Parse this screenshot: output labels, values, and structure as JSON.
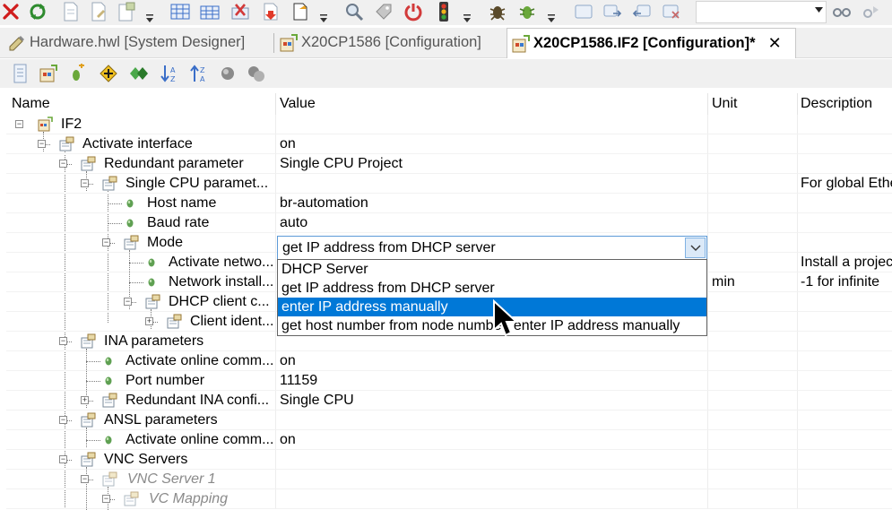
{
  "toolbar": {
    "icons": [
      "close-icon",
      "refresh-icon",
      "page-icon",
      "page-edit-icon",
      "page-settings-icon",
      "dropdown-arrow",
      "grid-icon",
      "grid-add-icon",
      "delete-icon",
      "download-icon",
      "page-open-icon",
      "dropdown-arrow",
      "search-icon",
      "tag-icon",
      "power-icon",
      "traffic-light-icon",
      "dropdown-arrow",
      "bug-icon",
      "bug-run-icon",
      "dropdown-arrow",
      "window-icon",
      "forward-icon",
      "back-icon",
      "window-close-icon"
    ],
    "combo_value": ""
  },
  "tabs": [
    {
      "label": "Hardware.hwl [System Designer]",
      "active": false
    },
    {
      "label": "X20CP1586 [Configuration]",
      "active": false
    },
    {
      "label": "X20CP1586.IF2 [Configuration]*",
      "active": true,
      "close": "✕"
    }
  ],
  "subtoolbar": {
    "icons": [
      "properties-icon",
      "module-icon",
      "leaf-add-icon",
      "diamond-icon",
      "diamonds-icon",
      "sort-desc-icon",
      "sort-asc-icon",
      "circle-icon",
      "circles-icon"
    ]
  },
  "grid": {
    "columns": [
      "Name",
      "Value",
      "Unit",
      "Description"
    ],
    "rows": [
      {
        "name": "IF2",
        "value": "",
        "unit": "",
        "desc": ""
      },
      {
        "name": "Activate interface",
        "value": "on",
        "unit": "",
        "desc": ""
      },
      {
        "name": "Redundant parameter",
        "value": "Single CPU Project",
        "unit": "",
        "desc": ""
      },
      {
        "name": "Single CPU paramet...",
        "value": "",
        "unit": "",
        "desc": "For global Ethe"
      },
      {
        "name": "Host name",
        "value": "br-automation",
        "unit": "",
        "desc": ""
      },
      {
        "name": "Baud rate",
        "value": "auto",
        "unit": "",
        "desc": ""
      },
      {
        "name": "Mode",
        "value": "",
        "unit": "",
        "desc": ""
      },
      {
        "name": "Activate netwo...",
        "value": "",
        "unit": "",
        "desc": "Install a projec"
      },
      {
        "name": "Network install...",
        "value": "",
        "unit": "min",
        "desc": "-1 for infinite"
      },
      {
        "name": "DHCP client c...",
        "value": "",
        "unit": "",
        "desc": ""
      },
      {
        "name": "Client ident...",
        "value": "",
        "unit": "",
        "desc": ""
      },
      {
        "name": "INA parameters",
        "value": "",
        "unit": "",
        "desc": ""
      },
      {
        "name": "Activate online comm...",
        "value": "on",
        "unit": "",
        "desc": ""
      },
      {
        "name": "Port number",
        "value": "11159",
        "unit": "",
        "desc": ""
      },
      {
        "name": "Redundant INA confi...",
        "value": "Single CPU",
        "unit": "",
        "desc": ""
      },
      {
        "name": "ANSL parameters",
        "value": "",
        "unit": "",
        "desc": ""
      },
      {
        "name": "Activate online comm...",
        "value": "on",
        "unit": "",
        "desc": ""
      },
      {
        "name": "VNC Servers",
        "value": "",
        "unit": "",
        "desc": ""
      },
      {
        "name": "VNC Server 1",
        "value": "",
        "unit": "",
        "desc": ""
      },
      {
        "name": "VC Mapping",
        "value": "",
        "unit": "",
        "desc": ""
      }
    ]
  },
  "mode_combo": {
    "value": "get IP address from DHCP server",
    "options": [
      "DHCP Server",
      "get IP address from DHCP server",
      "enter IP address manually",
      "get host number from node number, enter IP address manually"
    ],
    "highlighted": "enter IP address manually"
  },
  "colors": {
    "selection": "#0078d7",
    "combo_border": "#5d9bd8",
    "leaf_icon": "#5fa052"
  }
}
